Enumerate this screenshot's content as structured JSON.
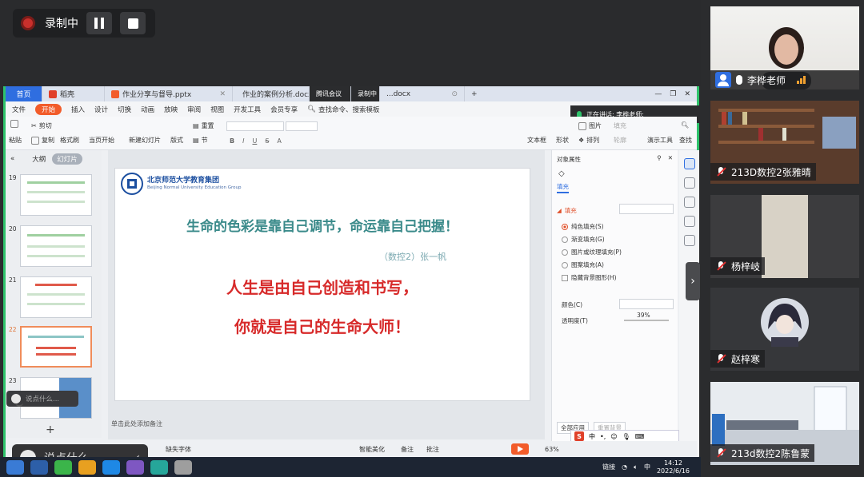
{
  "recording": {
    "label": "录制中"
  },
  "tabs": [
    {
      "label": "首页"
    },
    {
      "label": "稻壳"
    },
    {
      "label": "作业分享与督导.pptx"
    },
    {
      "label": "作业的案例分析.docx"
    },
    {
      "label": "腾讯会议"
    },
    {
      "label": "录制中"
    },
    {
      "label": "...docx"
    }
  ],
  "menu": [
    "文件",
    "开始",
    "插入",
    "设计",
    "切换",
    "动画",
    "放映",
    "审阅",
    "视图",
    "开发工具",
    "会员专享"
  ],
  "menu_search": "查找命令、搜索模板",
  "speaking": "正在讲话: 李桦老师;",
  "ribbon": {
    "paste": "粘贴",
    "cut": "剪切",
    "copy": "复制",
    "format": "格式刷",
    "current_start": "当页开始",
    "new_slide": "新建幻灯片",
    "layout": "版式",
    "section": "节",
    "reset": "重置",
    "textbox": "文本框",
    "shape": "形状",
    "arrange": "排列",
    "picture": "图片",
    "fill": "填充",
    "outline": "轮廓",
    "tools": "演示工具",
    "find": "查找"
  },
  "left_pane": {
    "outline_tab": "大纲",
    "slides_tab": "幻灯片"
  },
  "thumbs": [
    {
      "num": "19"
    },
    {
      "num": "20"
    },
    {
      "num": "21"
    },
    {
      "num": "22"
    },
    {
      "num": "23"
    }
  ],
  "slide": {
    "logo_cn": "北京师范大学教育集团",
    "logo_en": "Beijing Normal University Education Group",
    "title": "生命的色彩是靠自己调节，命运靠自己把握！",
    "author": "（数控2）张一帆",
    "line1": "人生是由自己创造和书写，",
    "line2": "你就是自己的生命大师！"
  },
  "notes_placeholder": "单击此处添加备注",
  "props": {
    "title": "对象属性",
    "tab": "填充",
    "section": "填充",
    "options": [
      "纯色填充(S)",
      "渐变填充(G)",
      "图片或纹理填充(P)",
      "图案填充(A)"
    ],
    "hide_bg": "隐藏背景图形(H)",
    "color_label": "颜色(C)",
    "transparency_label": "透明度(T)",
    "transparency_value": "39%",
    "apply_all": "全部应用",
    "reset_bg": "重置背景"
  },
  "status": {
    "beautify": "智能美化",
    "notes": "备注",
    "comments": "批注",
    "zoom": "63%",
    "missing_font": "缺失字体"
  },
  "chat": {
    "small": "说点什么...",
    "large": "说点什么..."
  },
  "clock": {
    "time": "14:12",
    "date": "2022/6/16"
  },
  "tray": {
    "label": "链接",
    "ime": "中"
  },
  "participants": [
    {
      "name": "李桦老师"
    },
    {
      "name": "213D数控2张雅晴"
    },
    {
      "name": "杨梓岐"
    },
    {
      "name": "赵梓寒"
    },
    {
      "name": "213d数控2陈鲁蒙"
    }
  ],
  "colors": {
    "accent_green": "#2ec26b",
    "wps_orange": "#f25c2a",
    "slide_red": "#d72a2a",
    "slide_teal": "#3a8a8a"
  }
}
